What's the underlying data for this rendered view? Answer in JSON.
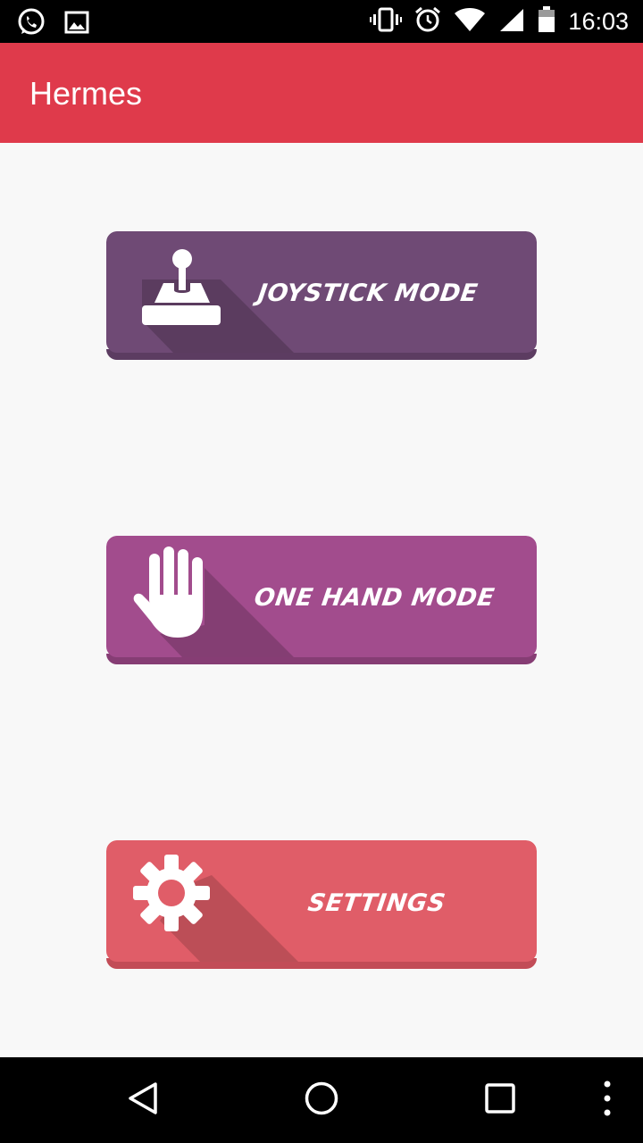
{
  "status_bar": {
    "time": "16:03",
    "left_icons": [
      "whatsapp-icon",
      "image-icon"
    ],
    "right_icons": [
      "vibrate-icon",
      "alarm-icon",
      "wifi-icon",
      "signal-icon",
      "battery-icon"
    ]
  },
  "app_bar": {
    "title": "Hermes",
    "color": "#DF3A4B"
  },
  "buttons": [
    {
      "label": "JOYSTICK MODE",
      "icon": "joystick-icon",
      "color": "#6F4A75"
    },
    {
      "label": "ONE HAND MODE",
      "icon": "hand-icon",
      "color": "#A24C8D"
    },
    {
      "label": "SETTINGS",
      "icon": "gear-icon",
      "color": "#E05D68"
    }
  ],
  "nav_bar": {
    "icons": [
      "back-icon",
      "home-icon",
      "recents-icon",
      "overflow-menu-icon"
    ]
  }
}
